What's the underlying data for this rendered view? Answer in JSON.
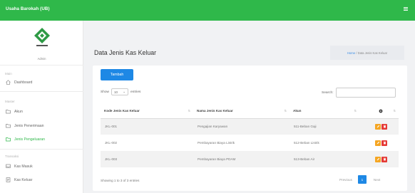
{
  "app": {
    "title": "Usaha Barokah (UB)",
    "menu_icon": "hamburger-icon"
  },
  "sidebar": {
    "user_label": "Admin",
    "section_main": "Main",
    "dashboard": "Dashboard",
    "section_master": "Master",
    "akun": "Akun",
    "jenis_penerimaan": "Jenis Penerimaan",
    "jenis_pengeluaran": "Jenis Pengeluaran",
    "section_transaksi": "Transaksi",
    "kas_masuk": "Kas Masuk",
    "kas_keluar": "Kas Keluar"
  },
  "page": {
    "title": "Data Jenis Kas Keluar",
    "breadcrumb_home": "Home",
    "breadcrumb_sep": " / ",
    "breadcrumb_current": "Data Jenis Kas Keluar"
  },
  "toolbar": {
    "add_label": "Tambah",
    "show_label": "Show",
    "entries_value": "10",
    "entries_label": "entries",
    "search_label": "Search:"
  },
  "table": {
    "headers": [
      "Kode Jenis Kas Keluar",
      "Nama Jenis Kas Keluar",
      "Akun"
    ],
    "rows": [
      {
        "kode": "JKL-001",
        "nama": "Pengajian Karyawan",
        "akun": "511-Beban Gaji"
      },
      {
        "kode": "JKL-002",
        "nama": "Pembayaran Biaya Listrik",
        "akun": "512-Beban Listrik"
      },
      {
        "kode": "JKL-003",
        "nama": "Pembayaran Biaya PDAM",
        "akun": "513-Beban Air"
      }
    ]
  },
  "footer": {
    "info": "Showing 1 to 3 of 3 entries",
    "previous": "Previous",
    "current_page": "1",
    "next": "Next"
  },
  "colors": {
    "brand": "#2fb84a",
    "primary": "#1e88e5",
    "edit": "#f5a623",
    "delete": "#e53935"
  }
}
